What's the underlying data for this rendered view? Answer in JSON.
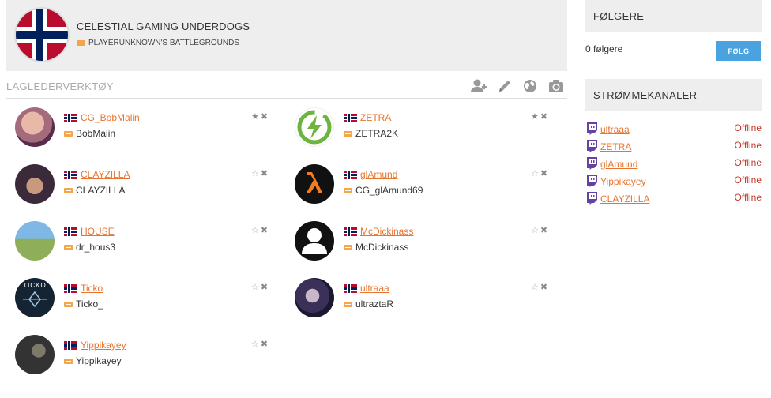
{
  "team": {
    "name": "CELESTIAL GAMING UNDERDOGS",
    "game": "PLAYERUNKNOWN'S BATTLEGROUNDS"
  },
  "tools": {
    "title": "LAGLEDERVERKTØY",
    "icons": [
      "add-user-icon",
      "pencil-icon",
      "globe-icon",
      "camera-icon"
    ]
  },
  "members": [
    {
      "nick": "CG_BobMalin",
      "game_name": "BobMalin",
      "starred": true
    },
    {
      "nick": "ZETRA",
      "game_name": "ZETRA2K",
      "starred": true
    },
    {
      "nick": "CLAYZILLA",
      "game_name": "CLAYZILLA",
      "starred": false
    },
    {
      "nick": "glAmund",
      "game_name": "CG_glAmund69",
      "starred": false
    },
    {
      "nick": "HOUSE",
      "game_name": "dr_hous3",
      "starred": false
    },
    {
      "nick": "McDickinass",
      "game_name": "McDickinass",
      "starred": false
    },
    {
      "nick": "Ticko",
      "game_name": "Ticko_",
      "starred": false,
      "avatar_text": "TICKO"
    },
    {
      "nick": "ultraaa",
      "game_name": "ultraztaR",
      "starred": false
    },
    {
      "nick": "Yippikayey",
      "game_name": "Yippikayey",
      "starred": false
    }
  ],
  "followers": {
    "title": "FØLGERE",
    "count_text": "0 følgere",
    "follow_label": "FØLG"
  },
  "streams": {
    "title": "STRØMMEKANALER",
    "items": [
      {
        "name": "ultraaa",
        "status": "Offline"
      },
      {
        "name": "ZETRA",
        "status": "Offline"
      },
      {
        "name": "glAmund",
        "status": "Offline"
      },
      {
        "name": "Yippikayey",
        "status": "Offline"
      },
      {
        "name": "CLAYZILLA",
        "status": "Offline"
      }
    ]
  },
  "colors": {
    "link": "#e8742e",
    "offline": "#c0392b",
    "follow_button": "#4aa3df",
    "twitch": "#6441a5"
  }
}
